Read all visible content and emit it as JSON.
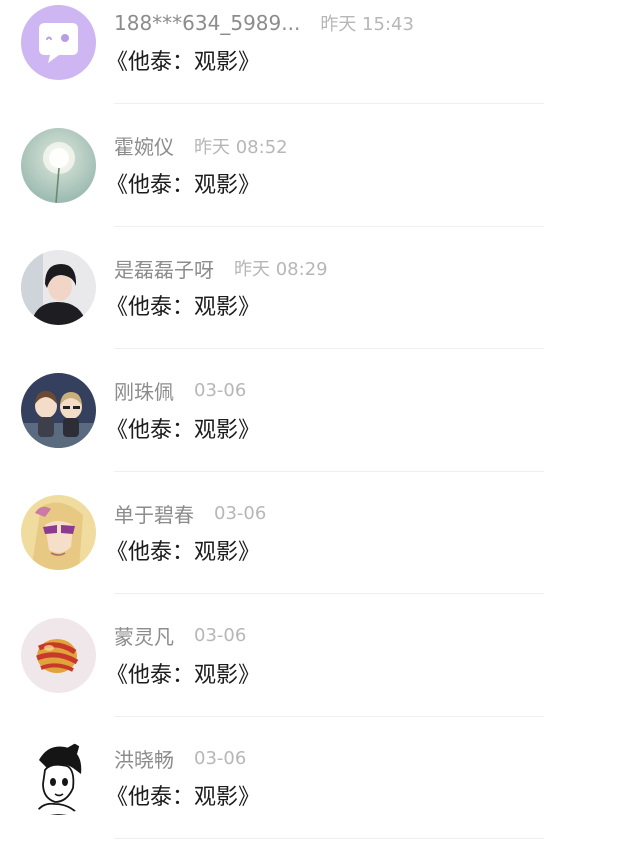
{
  "comments": [
    {
      "name": "188***634_5989...",
      "time": "昨天 15:43",
      "text": "《他泰：观影》",
      "avatar": "chat-bubble-face-icon"
    },
    {
      "name": "霍婉仪",
      "time": "昨天 08:52",
      "text": "《他泰：观影》",
      "avatar": "dandelion-photo"
    },
    {
      "name": "是磊磊子呀",
      "time": "昨天 08:29",
      "text": "《他泰：观影》",
      "avatar": "person-photo"
    },
    {
      "name": "刚珠佩",
      "time": "03-06",
      "text": "《他泰：观影》",
      "avatar": "chibi-couple-illustration"
    },
    {
      "name": "单于碧春",
      "time": "03-06",
      "text": "《他泰：观影》",
      "avatar": "anime-sunglasses-illustration"
    },
    {
      "name": "蒙灵凡",
      "time": "03-06",
      "text": "《他泰：观影》",
      "avatar": "striped-shell-photo"
    },
    {
      "name": "洪晓畅",
      "time": "03-06",
      "text": "《他泰：观影》",
      "avatar": "manga-girl-illustration"
    }
  ],
  "colors": {
    "name_text": "#8c8c8c",
    "time_text": "#b7b7b7",
    "body_text": "#1c1c1c",
    "divider": "#efefef",
    "accent_avatar": "#c9b3f0"
  }
}
